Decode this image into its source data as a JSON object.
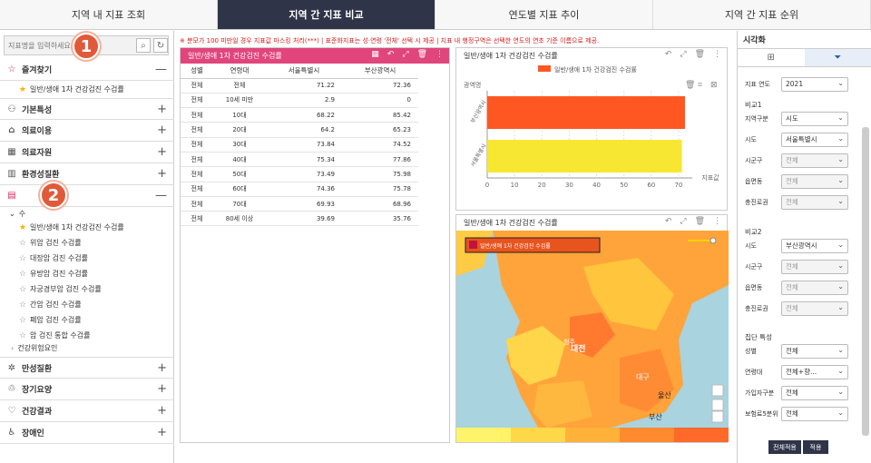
{
  "tabs": [
    "지역 내 지표 조회",
    "지역 간 지표 비교",
    "연도별 지표 추이",
    "지역 간 지표 순위"
  ],
  "search": {
    "placeholder": "지표명을 입력하세요"
  },
  "markers": [
    "1",
    "2"
  ],
  "sidebar": {
    "favorites": {
      "label": "즐겨찾기",
      "items": [
        "일반/생애 1차 건강검진 수검률"
      ]
    },
    "categories": [
      "기본특성",
      "의료이용",
      "의료자원",
      "환경성질환"
    ],
    "checkup": {
      "label": "검진",
      "sub_head": "수",
      "items": [
        "일반/생애 1차 건강검진 수검률",
        "위암 검진 수검률",
        "대장암 검진 수검률",
        "유방암 검진 수검률",
        "자궁경부암 검진 수검률",
        "간암 검진 수검률",
        "폐암 검진 수검률",
        "암 검진 통합 수검률"
      ],
      "risk": "건강위험요인"
    },
    "bottom": [
      "만성질환",
      "장기요양",
      "건강결과",
      "장애인"
    ]
  },
  "notice": "※ 분모가 100 미만일 경우 지표값 마스킹 처리(***) | 표준화지표는 성·연령 '전체' 선택 시 제공 | 지표 내 행정구역은 선택한 연도의 연초 기준 이름으로 제공.",
  "table_panel": {
    "title": "일반/생애 1차 건강검진 수검률",
    "headers": [
      "성별",
      "연령대",
      "서울특별시",
      "부산광역시"
    ],
    "rows": [
      [
        "전체",
        "전체",
        "71.22",
        "72.36"
      ],
      [
        "전체",
        "10세 미만",
        "2.9",
        "0"
      ],
      [
        "전체",
        "10대",
        "68.22",
        "85.42"
      ],
      [
        "전체",
        "20대",
        "64.2",
        "65.23"
      ],
      [
        "전체",
        "30대",
        "73.84",
        "74.52"
      ],
      [
        "전체",
        "40대",
        "75.34",
        "77.86"
      ],
      [
        "전체",
        "50대",
        "73.49",
        "75.98"
      ],
      [
        "전체",
        "60대",
        "74.36",
        "75.78"
      ],
      [
        "전체",
        "70대",
        "69.93",
        "68.96"
      ],
      [
        "전체",
        "80세 이상",
        "39.69",
        "35.76"
      ]
    ]
  },
  "chart_panel": {
    "title": "일반/생애 1차 건강검진 수검률"
  },
  "chart_data": {
    "type": "bar",
    "orientation": "horizontal",
    "title": "",
    "legend": [
      "일반/생애 1차 건강검진 수검률"
    ],
    "legend_position": "top",
    "ylabel": "광역명",
    "xlabel": "지표값",
    "categories": [
      "부산광역시",
      "서울특별시"
    ],
    "values": [
      72.36,
      71.22
    ],
    "colors": [
      "#ff5722",
      "#f7e733"
    ],
    "xticks": [
      0,
      10,
      20,
      30,
      40,
      50,
      60,
      70
    ],
    "xlim": [
      0,
      75
    ],
    "grid": true
  },
  "map_panel": {
    "title": "일반/생애 1차 건강검진 수검률",
    "legend_label": "일반/생애 1차 건강검진 수검률",
    "places": [
      "청주",
      "대전",
      "대구",
      "울산",
      "부산"
    ],
    "scale_colors": [
      "#fff36b",
      "#ffd84a",
      "#ffb13a",
      "#ff8a2f",
      "#ff6a2a"
    ]
  },
  "right": {
    "title": "시각화",
    "year_label": "지표 연도",
    "year": "2021",
    "group1": "비교1",
    "g1": [
      [
        "지역구분",
        "시도",
        false
      ],
      [
        "시도",
        "서울특별시",
        false
      ],
      [
        "시군구",
        "전체",
        true
      ],
      [
        "읍면동",
        "전체",
        true
      ],
      [
        "충진로권",
        "전체",
        true
      ]
    ],
    "group2": "비교2",
    "g2": [
      [
        "시도",
        "부산광역시",
        false
      ],
      [
        "시군구",
        "전체",
        true
      ],
      [
        "읍면동",
        "전체",
        true
      ],
      [
        "충진로권",
        "전체",
        true
      ]
    ],
    "group3": "집단 특성",
    "g3": [
      [
        "성별",
        "전체",
        false
      ],
      [
        "연령대",
        "전체+향...",
        false
      ],
      [
        "가입자구분",
        "전체",
        false
      ],
      [
        "보험료5분위",
        "전체",
        false
      ]
    ],
    "btn_all": "전체적용",
    "btn_apply": "적용"
  }
}
